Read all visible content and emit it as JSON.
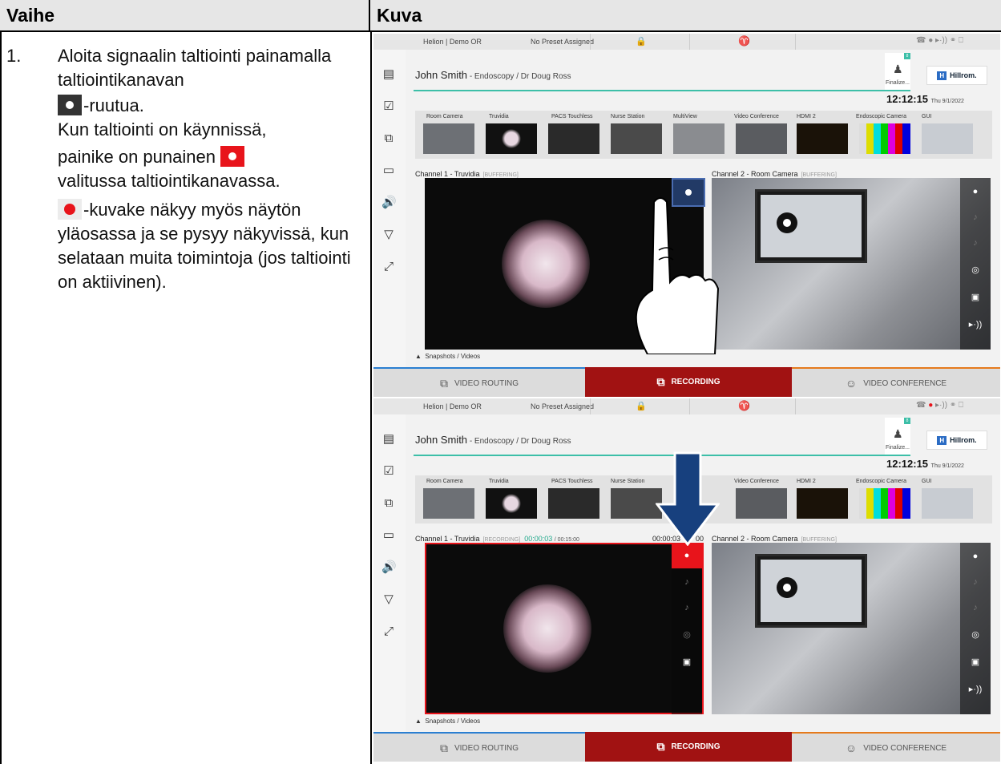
{
  "table": {
    "header_step": "Vaihe",
    "header_image": "Kuva"
  },
  "step": {
    "number": "1.",
    "line1": "Aloita signaalin taltiointi painamalla taltiointikanavan",
    "line2": "-ruutua.",
    "line3": "Kun taltiointi on käynnissä,",
    "line4": "painike on punainen",
    "line5": "valitussa taltiointikanavassa.",
    "line6": "-kuvake näkyy myös näytön yläosassa ja se pysyy näkyvissä, kun selataan muita toimintoja (jos taltiointi on aktiivinen)."
  },
  "ui": {
    "location": "Helion | Demo OR",
    "preset": "No Preset Assigned",
    "patient_name": "John Smith",
    "patient_detail": " - Endoscopy / Dr Doug Ross",
    "finalize": "Finalize...",
    "badge": "8",
    "brand": "Hillrom.",
    "time": "12:12:15",
    "date": "Thu 9/1/2022",
    "sources": [
      "Room Camera",
      "Truvidia",
      "PACS Touchless",
      "Nurse Station",
      "MultiView",
      "Video Conference",
      "HDMI 2",
      "Endoscopic Camera",
      "GUI"
    ],
    "channel1": "Channel 1 - Truvidia",
    "channel2": "Channel 2 - Room Camera",
    "buffering": "[BUFFERING]",
    "recording_state": "[RECORDING]",
    "elapsed": "00:00:03",
    "limit": "/ 00:15:00",
    "elapsed2": "00:00:03",
    "limit2": "00",
    "snapshots": "Snapshots / Videos",
    "tab_routing": "VIDEO ROUTING",
    "tab_recording": "RECORDING",
    "tab_conference": "VIDEO CONFERENCE"
  },
  "colors": {
    "record_red": "#e8141b",
    "teal": "#3dbfa8",
    "tab_red": "#a11212",
    "arrow_blue": "#17407e"
  }
}
